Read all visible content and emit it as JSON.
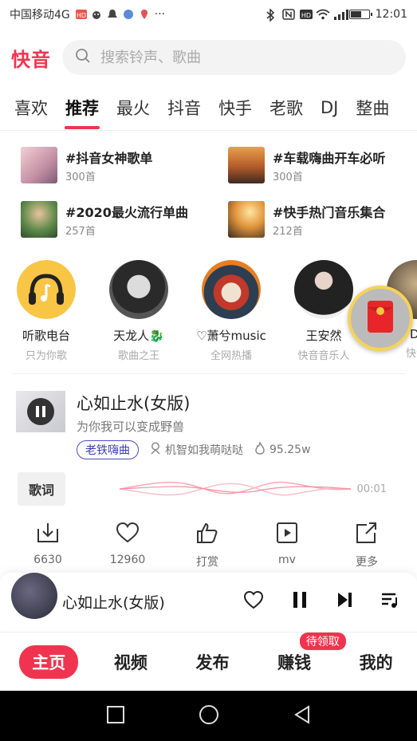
{
  "status_bar": {
    "carrier": "中国移动4G",
    "time": "12:01",
    "more": "···",
    "battery_level": 0.55
  },
  "header": {
    "logo": "快音",
    "search_placeholder": "搜索铃声、歌曲"
  },
  "tabs": [
    "喜欢",
    "推荐",
    "最火",
    "抖音",
    "快手",
    "老歌",
    "DJ",
    "整曲"
  ],
  "active_tab": "推荐",
  "playlists": [
    {
      "title": "#抖音女神歌单",
      "count": "300首"
    },
    {
      "title": "#车载嗨曲开车必听",
      "count": "300首"
    },
    {
      "title": "#2020最火流行单曲",
      "count": "257首"
    },
    {
      "title": "#快手热门音乐集合",
      "count": "212首"
    }
  ],
  "artists": [
    {
      "name": "听歌电台",
      "subtitle": "只为你歌"
    },
    {
      "name": "天龙人🐉",
      "subtitle": "歌曲之王"
    },
    {
      "name": "♡萧兮music",
      "subtitle": "全网热播"
    },
    {
      "name": "王安然",
      "subtitle": "快音音乐人"
    },
    {
      "name": "DJ",
      "subtitle": "快音"
    }
  ],
  "song": {
    "title": "心如止水(女版)",
    "subtitle": "为你我可以变成野兽",
    "tag": "老铁嗨曲",
    "uploader": "机智如我萌哒哒",
    "plays": "95.25w",
    "lyrics_label": "歌词",
    "time": "00:01"
  },
  "actions": [
    {
      "icon": "download-icon",
      "label": "6630"
    },
    {
      "icon": "heart-icon",
      "label": "12960"
    },
    {
      "icon": "reward-icon",
      "label": "打赏"
    },
    {
      "icon": "mv-icon",
      "label": "mv"
    },
    {
      "icon": "share-icon",
      "label": "更多"
    }
  ],
  "player": {
    "title": "心如止水(女版)"
  },
  "bottom_nav": [
    {
      "label": "主页",
      "active": true
    },
    {
      "label": "视频"
    },
    {
      "label": "发布"
    },
    {
      "label": "赚钱",
      "badge": "待领取"
    },
    {
      "label": "我的"
    }
  ],
  "colors": {
    "accent": "#f0344f",
    "tag_border": "#4b4bbf",
    "redpacket_ring": "#f6d25a"
  }
}
